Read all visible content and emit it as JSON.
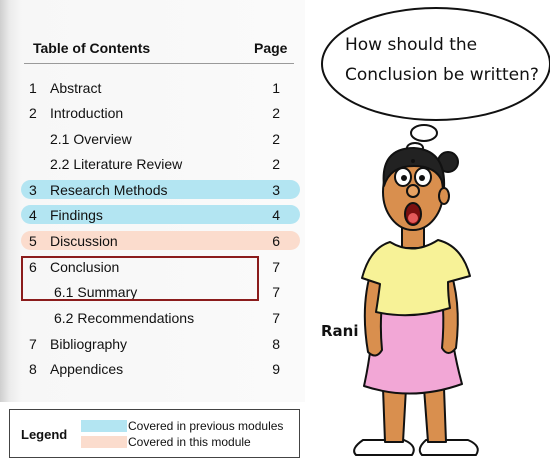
{
  "toc": {
    "heading": "Table of Contents",
    "page_heading": "Page",
    "entries": [
      {
        "num": "1",
        "title": "Abstract",
        "page": "1"
      },
      {
        "num": "2",
        "title": "Introduction",
        "page": "2"
      },
      {
        "num": "",
        "title": "2.1 Overview",
        "page": "2"
      },
      {
        "num": "",
        "title": "2.2 Literature Review",
        "page": "2"
      },
      {
        "num": "3",
        "title": "Research Methods",
        "page": "3"
      },
      {
        "num": "4",
        "title": "Findings",
        "page": "4"
      },
      {
        "num": "5",
        "title": "Discussion",
        "page": "6"
      },
      {
        "num": "6",
        "title": "Conclusion",
        "page": "7"
      },
      {
        "num": "",
        "title": "6.1 Summary",
        "page": "7"
      },
      {
        "num": "",
        "title": "6.2 Recommendations",
        "page": "7"
      },
      {
        "num": "7",
        "title": "Bibliography",
        "page": "8"
      },
      {
        "num": "8",
        "title": "Appendices",
        "page": "9"
      }
    ]
  },
  "legend": {
    "title": "Legend",
    "items": [
      {
        "label": "Covered in previous modules",
        "color": "#b3e5f2"
      },
      {
        "label": "Covered in this module",
        "color": "#fbdccd"
      }
    ]
  },
  "thought_bubble": {
    "line1": "How should the",
    "line2": "Conclusion be written?"
  },
  "character": {
    "name": "Rani"
  },
  "colors": {
    "previous_highlight": "#b3e5f2",
    "current_highlight": "#fbdccd",
    "selection_border": "#8b1c1c",
    "skin": "#d98f4e",
    "blouse": "#f7f297",
    "skirt": "#f2a7d6"
  }
}
